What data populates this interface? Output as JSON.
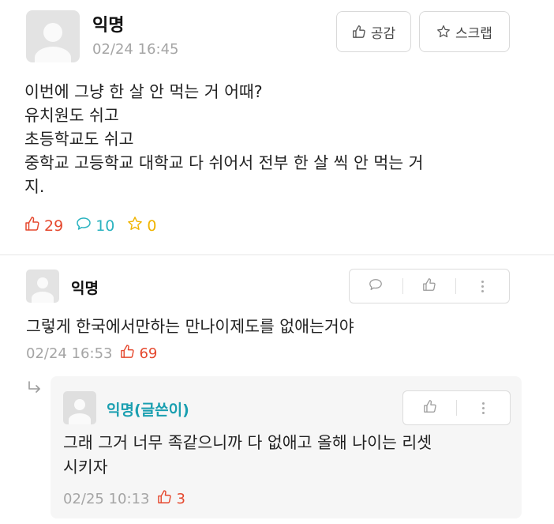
{
  "post": {
    "author": "익명",
    "timestamp": "02/24 16:45",
    "like_button_label": "공감",
    "scrap_button_label": "스크랩",
    "body_lines": [
      "이번에 그냥 한 살 안 먹는 거 어때?",
      "유치원도 쉬고",
      "초등학교도 쉬고",
      "중학교 고등학교 대학교 다 쉬어서 전부 한 살 씩 안 먹는 거",
      "지."
    ],
    "likes": "29",
    "comments": "10",
    "scraps": "0"
  },
  "comment": {
    "author": "익명",
    "text": "그렇게 한국에서만하는 만나이제도를 없애는거야",
    "timestamp": "02/24 16:53",
    "likes": "69"
  },
  "reply": {
    "author": "익명(글쓴이)",
    "text_lines": [
      "그래 그거 너무 족같으니까 다 없애고 올해 나이는 리셋",
      "시키자"
    ],
    "timestamp": "02/25 10:13",
    "likes": "3"
  },
  "colors": {
    "like_red": "#e5492f",
    "comment_teal": "#2bb3c0",
    "scrap_yellow": "#f0b400",
    "author_op_teal": "#1a9fb0",
    "muted": "#a5a5a5"
  },
  "icons": {
    "like": "thumbs-up-icon",
    "comment": "speech-bubble-icon",
    "scrap": "star-icon",
    "more": "vertical-dots-icon",
    "reply": "reply-arrow-icon"
  }
}
